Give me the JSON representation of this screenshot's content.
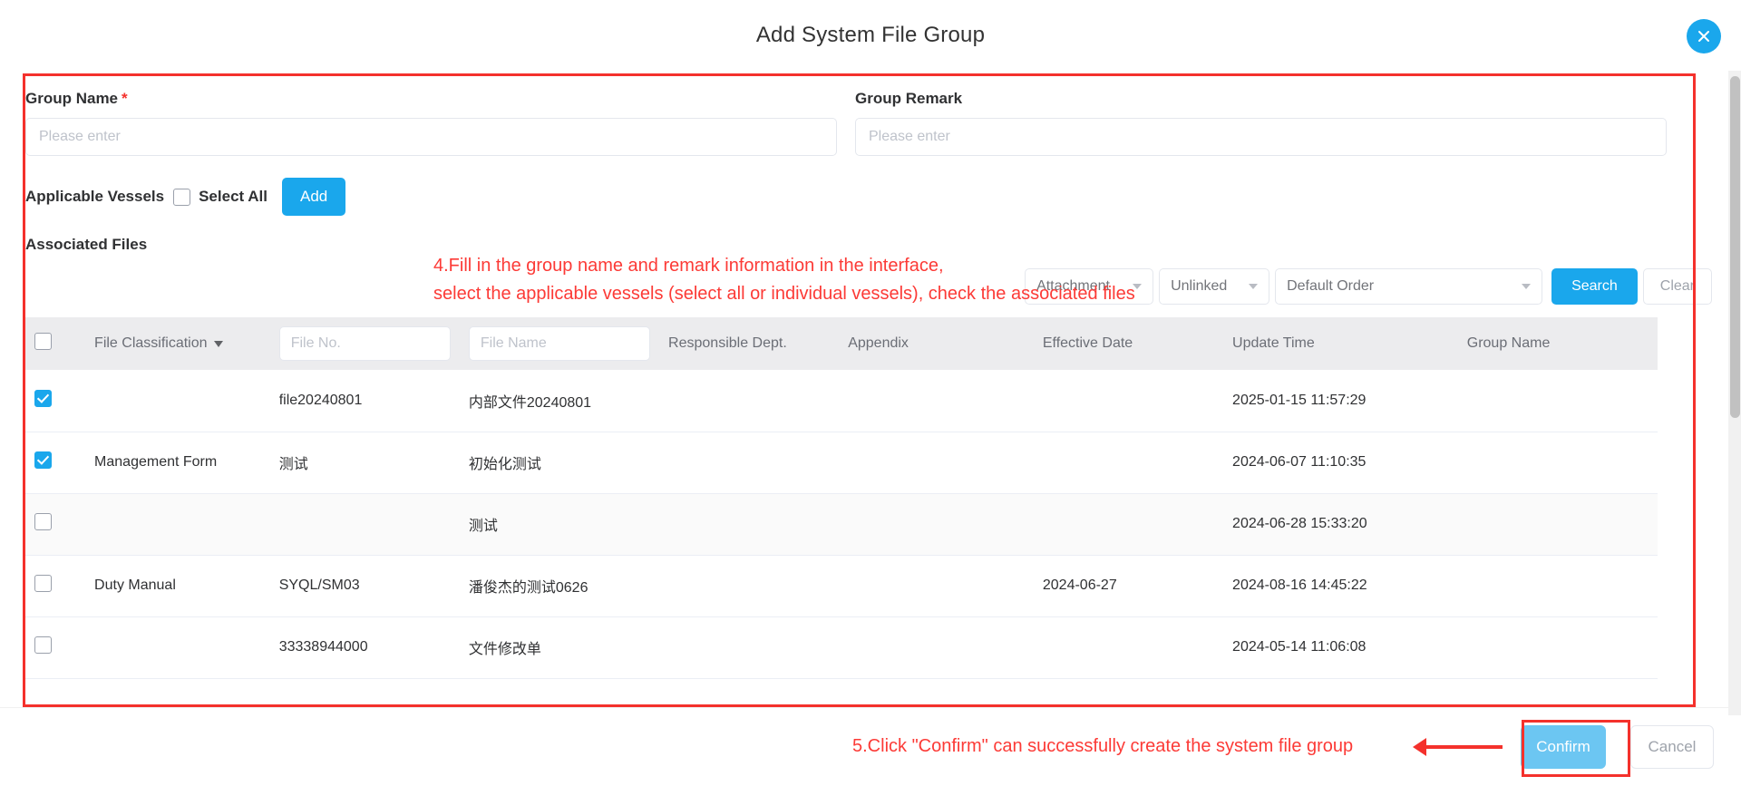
{
  "header": {
    "title": "Add System File Group",
    "close_icon": "close-icon"
  },
  "form": {
    "group_name_label": "Group Name",
    "group_name_required_mark": "*",
    "group_name_value": "",
    "group_name_placeholder": "Please enter",
    "group_remark_label": "Group Remark",
    "group_remark_value": "",
    "group_remark_placeholder": "Please enter",
    "applicable_vessels_label": "Applicable Vessels",
    "select_all_label": "Select All",
    "select_all_checked": false,
    "add_button_label": "Add",
    "associated_files_label": "Associated Files"
  },
  "annotations": {
    "step4": "4.Fill in the group name and remark information in the interface,\nselect the applicable vessels (select all or individual vessels), check the associated files",
    "step5": "5.Click \"Confirm\" can successfully create the system file group",
    "color": "#fc3a36"
  },
  "filters": {
    "attachment_select": "Attachment",
    "linked_select": "Unlinked",
    "order_select": "Default Order",
    "search_button": "Search",
    "clear_button": "Clear"
  },
  "table": {
    "header_select_all_checked": false,
    "columns": [
      {
        "key": "checkbox",
        "label": ""
      },
      {
        "key": "classification",
        "label": "File Classification",
        "sortable": true
      },
      {
        "key": "file_no",
        "label": "",
        "placeholder": "File No."
      },
      {
        "key": "file_name",
        "label": "",
        "placeholder": "File Name"
      },
      {
        "key": "dept",
        "label": "Responsible Dept."
      },
      {
        "key": "appendix",
        "label": "Appendix"
      },
      {
        "key": "effective_date",
        "label": "Effective Date"
      },
      {
        "key": "update_time",
        "label": "Update Time"
      },
      {
        "key": "group_name",
        "label": "Group Name"
      }
    ],
    "filter_values": {
      "file_no": "",
      "file_name": ""
    },
    "rows": [
      {
        "checked": true,
        "classification": "",
        "file_no": "file20240801",
        "file_name": "内部文件20240801",
        "dept": "",
        "appendix": "",
        "effective_date": "",
        "update_time": "2025-01-15 11:57:29",
        "group_name": ""
      },
      {
        "checked": true,
        "classification": "Management Form",
        "file_no": "测试",
        "file_name": "初始化测试",
        "dept": "",
        "appendix": "",
        "effective_date": "",
        "update_time": "2024-06-07 11:10:35",
        "group_name": ""
      },
      {
        "checked": false,
        "classification": "",
        "file_no": "",
        "file_name": "测试",
        "dept": "",
        "appendix": "",
        "effective_date": "",
        "update_time": "2024-06-28 15:33:20",
        "group_name": ""
      },
      {
        "checked": false,
        "classification": "Duty Manual",
        "file_no": "SYQL/SM03",
        "file_name": "潘俊杰的测试0626",
        "dept": "",
        "appendix": "",
        "effective_date": "2024-06-27",
        "update_time": "2024-08-16 14:45:22",
        "group_name": ""
      },
      {
        "checked": false,
        "classification": "",
        "file_no": "33338944000",
        "file_name": "文件修改单",
        "dept": "",
        "appendix": "",
        "effective_date": "",
        "update_time": "2024-05-14 11:06:08",
        "group_name": ""
      }
    ]
  },
  "footer": {
    "confirm_button": "Confirm",
    "cancel_button": "Cancel"
  },
  "colors": {
    "primary": "#1aa7ec",
    "confirm": "#6cc6f2",
    "annotation_red": "#fc3a36",
    "frame_red": "#f4312c"
  }
}
